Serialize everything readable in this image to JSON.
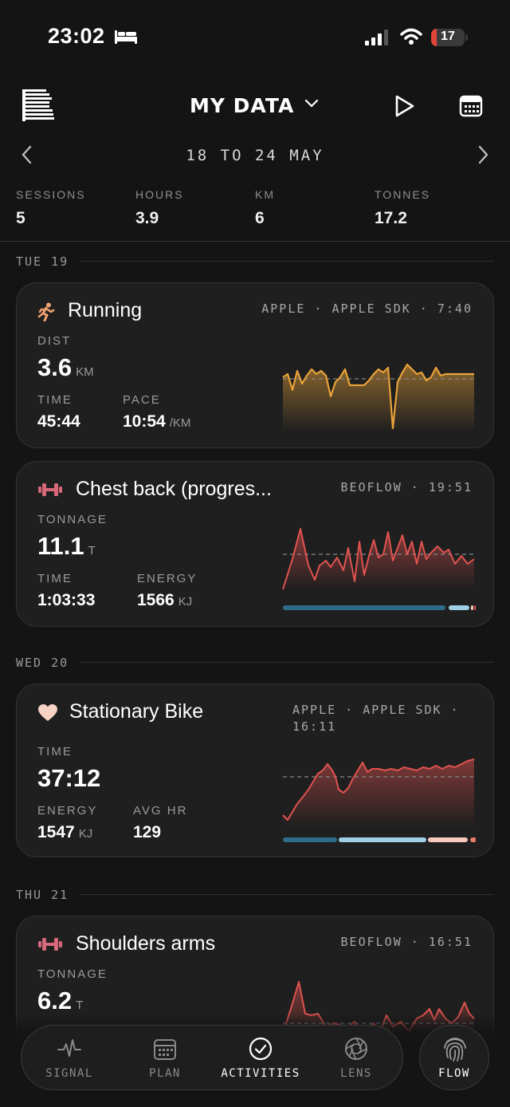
{
  "status_bar": {
    "time": "23:02",
    "battery": "17",
    "battery_level": 0.17
  },
  "header": {
    "title": "MY DATA"
  },
  "date_nav": {
    "range": "18 TO 24 MAY"
  },
  "summary": [
    {
      "label": "SESSIONS",
      "value": "5"
    },
    {
      "label": "HOURS",
      "value": "3.9"
    },
    {
      "label": "KM",
      "value": "6"
    },
    {
      "label": "TONNES",
      "value": "17.2"
    }
  ],
  "days": [
    {
      "label": "TUE 19"
    },
    {
      "label": "WED 20"
    },
    {
      "label": "THU 21"
    }
  ],
  "activities": [
    {
      "title": "Running",
      "icon": "running-icon",
      "source": "APPLE · APPLE SDK · 7:40",
      "primary": {
        "label": "DIST",
        "value": "3.6",
        "unit": "KM"
      },
      "metrics": [
        {
          "label": "TIME",
          "value": "45:44",
          "unit": ""
        },
        {
          "label": "PACE",
          "value": "10:54",
          "unit": "/KM"
        }
      ],
      "color": "#e8a23a"
    },
    {
      "title": "Chest back (progres...",
      "icon": "dumbbell-icon",
      "source": "BEOFLOW · 19:51",
      "primary": {
        "label": "TONNAGE",
        "value": "11.1",
        "unit": "T"
      },
      "metrics": [
        {
          "label": "TIME",
          "value": "1:03:33",
          "unit": ""
        },
        {
          "label": "ENERGY",
          "value": "1566",
          "unit": "KJ"
        }
      ],
      "color": "#e0534f"
    },
    {
      "title": "Stationary Bike",
      "icon": "heart-icon",
      "source_line1": "APPLE · APPLE SDK ·",
      "source_line2": "16:11",
      "primary": {
        "label": "TIME",
        "value": "37:12",
        "unit": ""
      },
      "metrics": [
        {
          "label": "ENERGY",
          "value": "1547",
          "unit": "KJ"
        },
        {
          "label": "AVG HR",
          "value": "129",
          "unit": ""
        }
      ],
      "color": "#e0534f"
    },
    {
      "title": "Shoulders arms",
      "icon": "dumbbell-icon",
      "source": "BEOFLOW · 16:51",
      "primary": {
        "label": "TONNAGE",
        "value": "6.2",
        "unit": "T"
      },
      "color": "#e0534f"
    }
  ],
  "nav": [
    {
      "label": "SIGNAL",
      "icon": "pulse-icon"
    },
    {
      "label": "PLAN",
      "icon": "calendar-icon"
    },
    {
      "label": "ACTIVITIES",
      "icon": "check-circle-icon"
    },
    {
      "label": "LENS",
      "icon": "aperture-icon"
    }
  ],
  "flow": {
    "label": "FLOW",
    "icon": "fingerprint-icon"
  },
  "colors": {
    "background": "#141414",
    "card": "#1f1f1f",
    "running": "#e8a23a",
    "strength": "#e0534f",
    "zone_blue": "#2f6c8a",
    "zone_light": "#9ecfe6",
    "zone_pink": "#f6c9bc"
  }
}
